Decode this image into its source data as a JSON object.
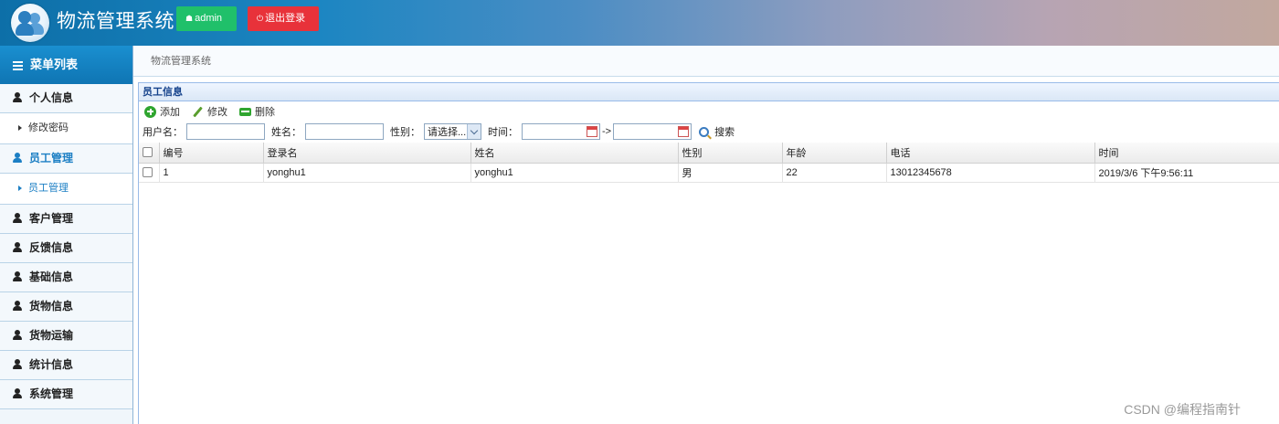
{
  "header": {
    "app_title": "物流管理系统",
    "admin_label": "admin",
    "logout_label": "退出登录",
    "colors": {
      "admin": "#20c06a",
      "logout": "#e8323a"
    }
  },
  "sidebar": {
    "title": "菜单列表",
    "items": [
      {
        "label": "个人信息",
        "type": "menu",
        "active": false
      },
      {
        "label": "修改密码",
        "type": "sub",
        "active": false
      },
      {
        "label": "员工管理",
        "type": "menu",
        "active": true
      },
      {
        "label": "员工管理",
        "type": "sub",
        "active": true
      },
      {
        "label": "客户管理",
        "type": "menu",
        "active": false
      },
      {
        "label": "反馈信息",
        "type": "menu",
        "active": false
      },
      {
        "label": "基础信息",
        "type": "menu",
        "active": false
      },
      {
        "label": "货物信息",
        "type": "menu",
        "active": false
      },
      {
        "label": "货物运输",
        "type": "menu",
        "active": false
      },
      {
        "label": "统计信息",
        "type": "menu",
        "active": false
      },
      {
        "label": "系统管理",
        "type": "menu",
        "active": false
      }
    ]
  },
  "breadcrumb": "物流管理系统",
  "panel": {
    "title": "员工信息",
    "toolbar": {
      "add": "添加",
      "edit": "修改",
      "delete": "删除"
    },
    "search": {
      "username_label": "用户名：",
      "username_value": "",
      "name_label": "姓名：",
      "name_value": "",
      "gender_label": "性别：",
      "gender_selected": "请选择...",
      "time_label": "时间：",
      "range_sep": "->",
      "search_label": "搜索"
    },
    "table": {
      "columns": [
        "编号",
        "登录名",
        "姓名",
        "性别",
        "年龄",
        "电话",
        "时间"
      ],
      "rows": [
        [
          "1",
          "yonghu1",
          "yonghu1",
          "男",
          "22",
          "13012345678",
          "2019/3/6 下午9:56:11"
        ]
      ]
    }
  },
  "watermark": "CSDN @编程指南针"
}
